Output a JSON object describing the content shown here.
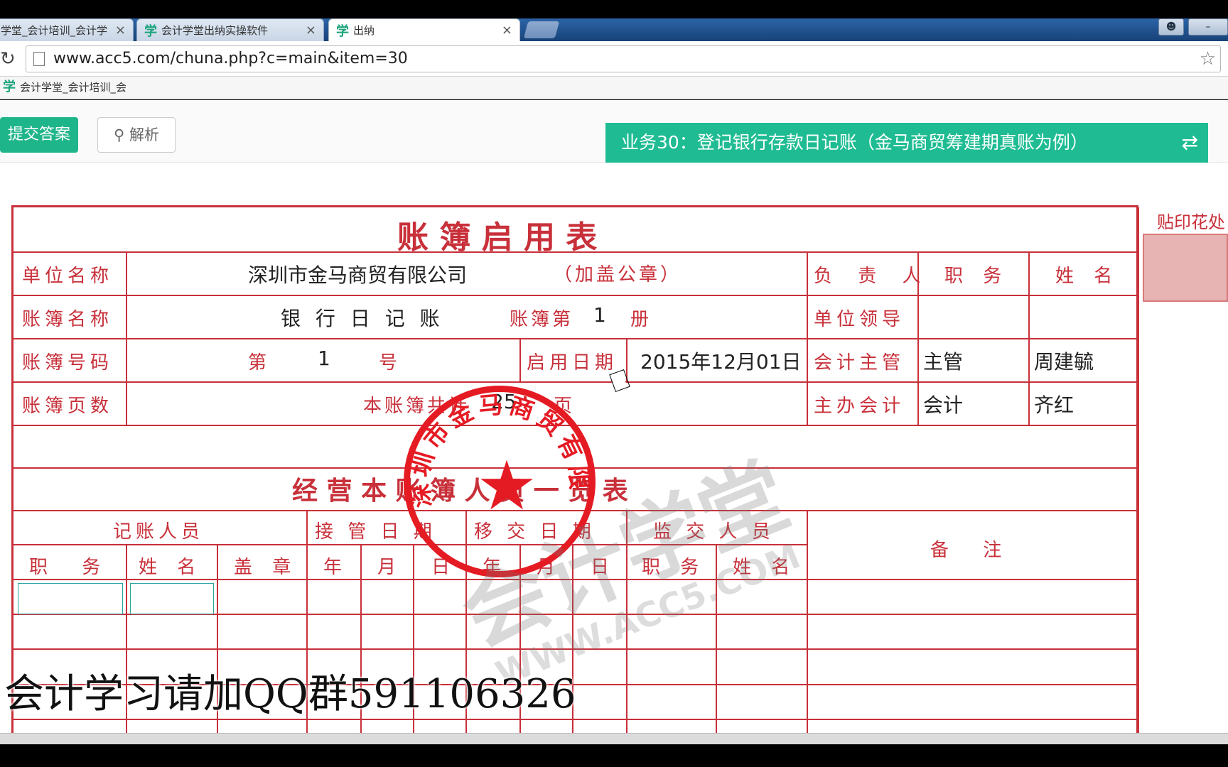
{
  "browser": {
    "tabs": [
      {
        "label": "学堂_会计培训_会计学"
      },
      {
        "label": "会计学堂出纳实操软件"
      },
      {
        "label": "出纳"
      }
    ],
    "tab_logo": "学",
    "url": "www.acc5.com/chuna.php?c=main&item=30",
    "bookmark": "会计学堂_会计培训_会"
  },
  "toolbar": {
    "submit_label": "提交答案",
    "analysis_label": "解析",
    "title": "业务30：登记银行存款日记账（金马商贸筹建期真账为例）",
    "swap_icon": "⇄"
  },
  "ledger": {
    "title": "账 簿 启 用 表",
    "stamp_label": "贴印花处",
    "rows": {
      "unit_name_label": "单位名称",
      "unit_name_value": "深圳市金马商贸有限公司",
      "seal_hint": "（加盖公章）",
      "book_name_label": "账簿名称",
      "book_name_value": "银 行 日 记 账",
      "book_volume_pre": "账簿第",
      "book_volume_num": "1",
      "book_volume_post": "册",
      "book_no_label": "账簿号码",
      "book_no_pre": "第",
      "book_no_num": "1",
      "book_no_post": "号",
      "start_date_label": "启用日期",
      "start_date_value": "2015年12月01日",
      "pages_label": "账簿页数",
      "pages_pre": "本账簿共计",
      "pages_num": "25",
      "pages_post": "页"
    },
    "responsible": {
      "header_role": "负 责 人",
      "header_title": "职 务",
      "header_name": "姓 名",
      "rows": [
        {
          "role": "单位领导",
          "title": "",
          "name": ""
        },
        {
          "role": "会计主管",
          "title": "主管",
          "name": "周建毓"
        },
        {
          "role": "主办会计",
          "title": "会计",
          "name": "齐红"
        }
      ]
    },
    "staff_title": "经 营 本 账 簿 人 员 一 览 表",
    "staff_headers": {
      "bookkeeper": "记账人员",
      "takeover_date": "接 管 日 期",
      "handover_date": "移 交 日 期",
      "supervisor": "监 交 人 员",
      "remarks": "备 注",
      "title": "职 务",
      "name": "姓 名",
      "seal": "盖 章",
      "year": "年",
      "month": "月",
      "day": "日"
    }
  },
  "seal": {
    "ring_text": "深圳市金马商贸有限公司"
  },
  "watermark": {
    "main": "会计学堂",
    "url": "WWW.ACC5.COM"
  },
  "caption": "会计学习请加QQ群591106326",
  "colors": {
    "accent": "#1fbc93",
    "ledger_red": "#c8303a",
    "seal_red": "#e51b24"
  }
}
